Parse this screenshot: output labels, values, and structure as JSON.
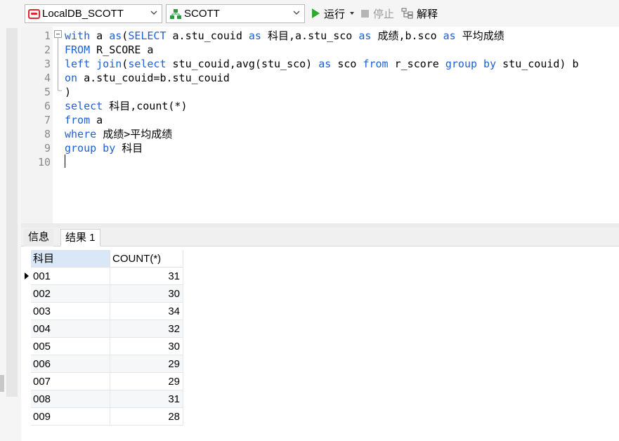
{
  "toolbar": {
    "connection": "LocalDB_SCOTT",
    "schema": "SCOTT",
    "run_label": "运行",
    "stop_label": "停止",
    "explain_label": "解释"
  },
  "editor": {
    "lines": [
      {
        "num": "1",
        "parts": [
          [
            "kw",
            "with "
          ],
          [
            "",
            "a "
          ],
          [
            "kw",
            "as"
          ],
          [
            "",
            "("
          ],
          [
            "kw",
            "SELECT "
          ],
          [
            "",
            "a.stu_couid "
          ],
          [
            "kw",
            "as "
          ],
          [
            "",
            "科目,a.stu_sco "
          ],
          [
            "kw",
            "as "
          ],
          [
            "",
            "成绩,b.sco "
          ],
          [
            "kw",
            "as "
          ],
          [
            "",
            "平均成绩"
          ]
        ]
      },
      {
        "num": "2",
        "parts": [
          [
            "kw",
            "FROM "
          ],
          [
            "",
            "R_SCORE a"
          ]
        ]
      },
      {
        "num": "3",
        "parts": [
          [
            "kw",
            "left join"
          ],
          [
            "",
            "("
          ],
          [
            "kw",
            "select "
          ],
          [
            "",
            "stu_couid,avg(stu_sco) "
          ],
          [
            "kw",
            "as "
          ],
          [
            "",
            "sco "
          ],
          [
            "kw",
            "from "
          ],
          [
            "",
            "r_score "
          ],
          [
            "kw",
            "group by "
          ],
          [
            "",
            "stu_couid) b"
          ]
        ]
      },
      {
        "num": "4",
        "parts": [
          [
            "kw",
            "on "
          ],
          [
            "",
            "a.stu_couid=b.stu_couid"
          ]
        ]
      },
      {
        "num": "5",
        "parts": [
          [
            "",
            ")"
          ]
        ]
      },
      {
        "num": "6",
        "parts": [
          [
            "kw",
            "select "
          ],
          [
            "",
            "科目,count(*)"
          ]
        ]
      },
      {
        "num": "7",
        "parts": [
          [
            "kw",
            "from "
          ],
          [
            "",
            "a"
          ]
        ]
      },
      {
        "num": "8",
        "parts": [
          [
            "kw",
            "where "
          ],
          [
            "",
            "成绩>平均成绩"
          ]
        ]
      },
      {
        "num": "9",
        "parts": [
          [
            "kw",
            "group by "
          ],
          [
            "",
            "科目"
          ]
        ]
      },
      {
        "num": "10",
        "parts": []
      }
    ]
  },
  "tabs": {
    "info": "信息",
    "result": "结果 1"
  },
  "grid": {
    "columns": [
      "科目",
      "COUNT(*)"
    ],
    "rows": [
      [
        "001",
        "31"
      ],
      [
        "002",
        "30"
      ],
      [
        "003",
        "34"
      ],
      [
        "004",
        "32"
      ],
      [
        "005",
        "30"
      ],
      [
        "006",
        "29"
      ],
      [
        "007",
        "29"
      ],
      [
        "008",
        "31"
      ],
      [
        "009",
        "28"
      ]
    ]
  },
  "colors": {
    "keyword": "#1f5fd6",
    "run_icon": "#2eaa2e",
    "connection_icon": "#e3262d"
  }
}
